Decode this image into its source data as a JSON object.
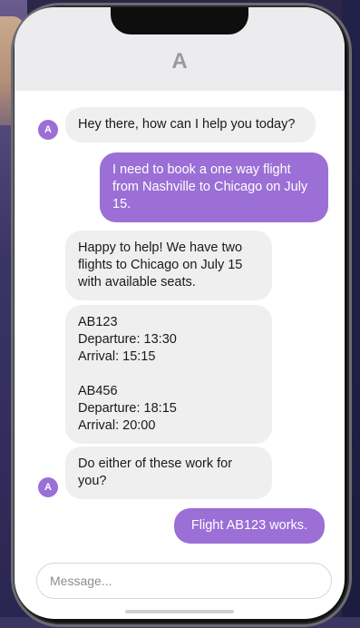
{
  "header": {
    "title": "A"
  },
  "avatar_letter": "A",
  "messages": [
    {
      "side": "in",
      "text": "Hey there, how can I help you today?"
    },
    {
      "side": "out",
      "text": "I need to book a one way flight from Nashville to Chicago on July 15."
    },
    {
      "side": "in",
      "text": "Happy to help! We have two flights to Chicago on July 15 with available seats."
    },
    {
      "side": "in",
      "lines": [
        "AB123",
        "Departure: 13:30",
        "Arrival: 15:15",
        "",
        "AB456",
        "Departure: 18:15",
        "Arrival: 20:00"
      ]
    },
    {
      "side": "in",
      "text": "Do either of these work for you?"
    },
    {
      "side": "out",
      "text": "Flight AB123 works."
    }
  ],
  "composer": {
    "placeholder": "Message..."
  },
  "colors": {
    "accent": "#9b6fd6",
    "incoming": "#efefef",
    "header": "#ececee"
  }
}
